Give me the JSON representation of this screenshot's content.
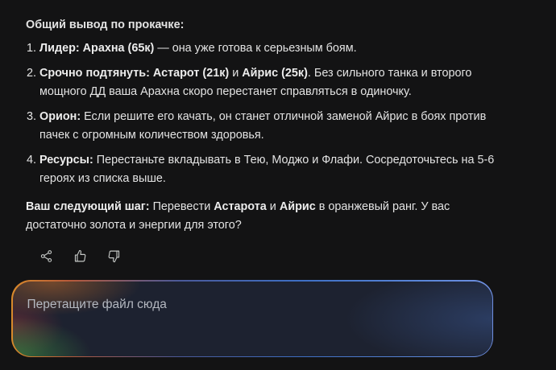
{
  "response": {
    "heading": "Общий вывод по прокачке:",
    "items": [
      {
        "number": "1.",
        "segments": [
          {
            "text": "Лидер: Арахна (65к)",
            "bold": true
          },
          {
            "text": " — она уже готова к серьезным боям.",
            "bold": false
          }
        ]
      },
      {
        "number": "2.",
        "segments": [
          {
            "text": "Срочно подтянуть: Астарот (21к)",
            "bold": true
          },
          {
            "text": " и ",
            "bold": false
          },
          {
            "text": "Айрис (25к)",
            "bold": true
          },
          {
            "text": ". Без сильного танка и второго мощного ДД ваша Арахна скоро перестанет справляться в одиночку.",
            "bold": false
          }
        ]
      },
      {
        "number": "3.",
        "segments": [
          {
            "text": "Орион:",
            "bold": true
          },
          {
            "text": " Если решите его качать, он станет отличной заменой Айрис в боях против пачек с огромным количеством здоровья.",
            "bold": false
          }
        ]
      },
      {
        "number": "4.",
        "segments": [
          {
            "text": "Ресурсы:",
            "bold": true
          },
          {
            "text": " Перестаньте вкладывать в Тею, Моджо и Флафи. Сосредоточьтесь на 5-6 героях из списка выше.",
            "bold": false
          }
        ]
      }
    ],
    "next_step": {
      "segments": [
        {
          "text": "Ваш следующий шаг:",
          "bold": true
        },
        {
          "text": " Перевести ",
          "bold": false
        },
        {
          "text": "Астарота",
          "bold": true
        },
        {
          "text": " и ",
          "bold": false
        },
        {
          "text": "Айрис",
          "bold": true
        },
        {
          "text": " в оранжевый ранг. У вас достаточно золота и энергии для этого?",
          "bold": false
        }
      ]
    }
  },
  "actions": {
    "share_icon": "share-icon",
    "like_icon": "thumbs-up-icon",
    "dislike_icon": "thumbs-down-icon"
  },
  "drop_zone": {
    "label": "Перетащите файл сюда"
  },
  "colors": {
    "background": "#131314",
    "text": "#e3e3e3",
    "drop_zone_fill": "#1d2230"
  }
}
